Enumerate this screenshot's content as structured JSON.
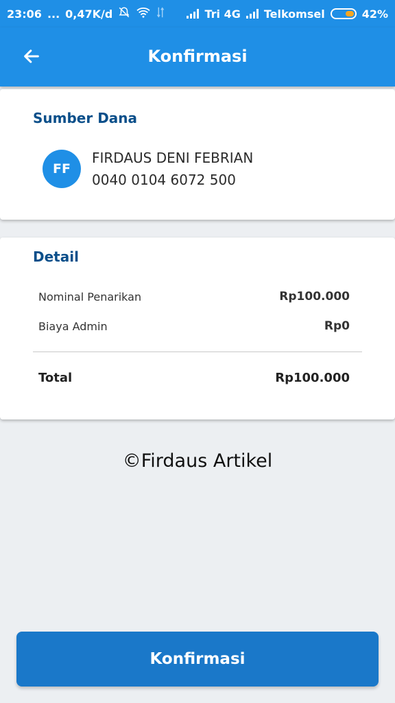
{
  "status_bar": {
    "time": "23:06",
    "dots": "...",
    "speed": "0,47K/d",
    "carrier1": "Tri 4G",
    "carrier2": "Telkomsel",
    "battery": "42%"
  },
  "header": {
    "title": "Konfirmasi"
  },
  "source": {
    "title": "Sumber Dana",
    "initials": "FF",
    "name": "FIRDAUS DENI FEBRIAN",
    "account_number": "0040 0104 6072 500"
  },
  "detail": {
    "title": "Detail",
    "rows": [
      {
        "label": "Nominal Penarikan",
        "value": "Rp100.000"
      },
      {
        "label": "Biaya Admin",
        "value": "Rp0"
      }
    ],
    "total": {
      "label": "Total",
      "value": "Rp100.000"
    }
  },
  "watermark": "©Firdaus Artikel",
  "footer": {
    "confirm_label": "Konfirmasi"
  },
  "colors": {
    "primary": "#1f8fe6",
    "button": "#1a78c9",
    "section_title": "#0b4f8a",
    "battery_fill": "#f5a623"
  }
}
